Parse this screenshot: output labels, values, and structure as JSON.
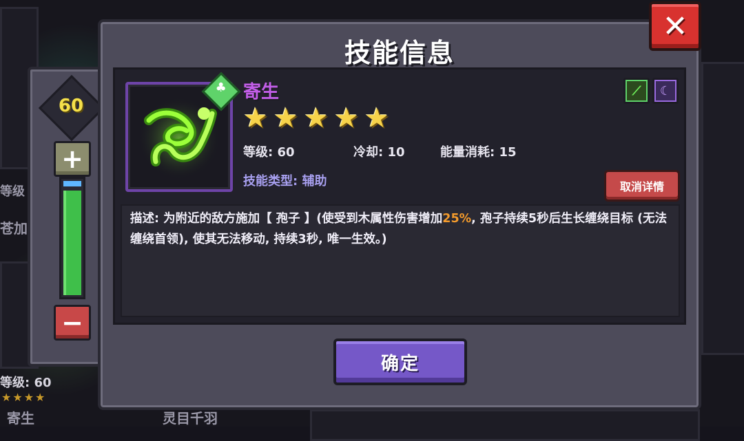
{
  "background": {
    "left_card_level_fragment": "等级",
    "left_card_name_fragment": "苍加",
    "bottom_left_level": "等级: 60",
    "bottom_left_stars": "★★★★",
    "bottom_left_name": "寄生",
    "bottom_center_name": "灵目千羽"
  },
  "level_panel": {
    "level": "60",
    "plus_label": "+",
    "minus_label": "−",
    "slider_value_fraction": 0.92
  },
  "dialog": {
    "title": "技能信息",
    "close_label": "✕",
    "skill": {
      "name": "寄生",
      "star_count": 5,
      "star_glyph": "★",
      "level": "等级: 60",
      "cooldown": "冷却: 10",
      "energy_cost": "能量消耗: 15",
      "type": "技能类型: 辅助",
      "element_icons": [
        "nature-icon",
        "magic-icon"
      ],
      "name_color": "#c25ee8"
    },
    "cancel_detail_label": "取消详情",
    "description": {
      "before": "描述: 为附近的敌方施加【 孢子 】(使受到木属性伤害增加",
      "highlight": "25%",
      "after": ", 孢子持续5秒后生长缠绕目标 (无法缠绕首领), 使其无法移动, 持续3秒, 唯一生效。)",
      "highlight_color": "#f39a2c"
    },
    "confirm_label": "确定"
  }
}
